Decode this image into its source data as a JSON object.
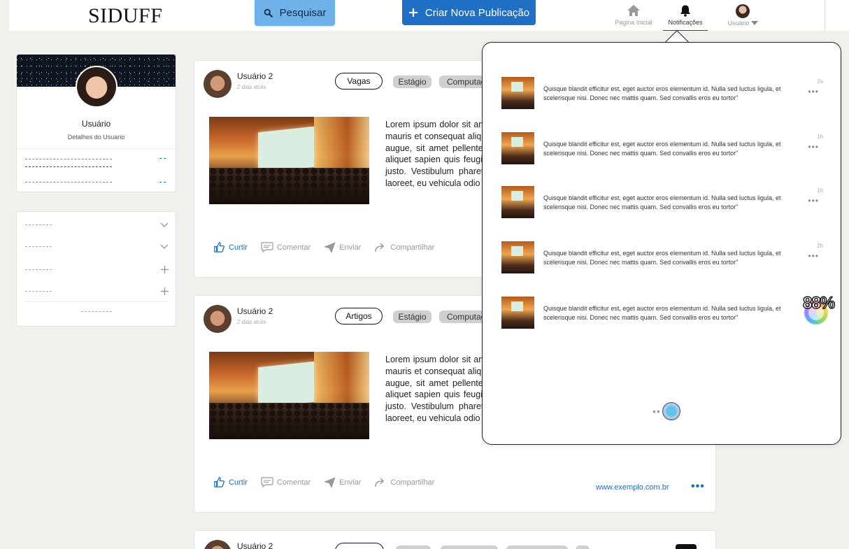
{
  "header": {
    "logo": "SIDUFF",
    "search_label": "Pesquisar",
    "create_label": "Criar Nova Publicação",
    "nav": {
      "home_label": "Pagina Inicial",
      "notifications_label": "Notificações",
      "user_label": "Usuário"
    }
  },
  "profile": {
    "name": "Usuário",
    "details": "Detalhes do Usuario"
  },
  "posts": [
    {
      "user": "Usuário 2",
      "time": "2 dias atrás",
      "category": "Vagas",
      "tags": [
        "Estágio",
        "Computação"
      ],
      "text": "Lorem ipsum dolor sit amet, consectetur adipiscing elit. Nunc malesuada pulvinar, mauris et consequat aliquet. Sed consequat feugiat nisi, vitae aliquam lorem porta augue, sit amet pellentesque nibh blandit eleifend, turpis est tristique orci, eget aliquet sapien quis feugiat. Praesent sit amet dolor, eget pharetra est, vel mattis justo. Vestibulum pharetra consectetur magna, ut ultrices sem libero vitae elit laoreet, eu vehicula odio facilisis.",
      "actions": {
        "like": "Curtir",
        "comment": "Comentar",
        "send": "Enviar",
        "share": "Compartilhar"
      },
      "link": ""
    },
    {
      "user": "Usuário 2",
      "time": "2 dias atrás",
      "category": "Artigos",
      "tags": [
        "Estágio",
        "Computação"
      ],
      "text": "Lorem ipsum dolor sit amet, consectetur adipiscing elit. Nunc malesuada pulvinar, mauris et consequat aliquet. Sed consequat feugiat nisi, vitae aliquam lorem porta augue, sit amet pellentesque nibh blandit eleifend, turpis est tristique orci, eget aliquet sapien quis feugiat. Praesent sit amet dolor, eget pharetra est, vel mattis justo. Vestibulum pharetra consectetur magna, ut ultrices sem libero vitae elit laoreet, eu vehicula odio facilisis.",
      "actions": {
        "like": "Curtir",
        "comment": "Comentar",
        "send": "Enviar",
        "share": "Compartilhar"
      },
      "link": "www.exemplo.com.br"
    },
    {
      "user": "Usuário 2"
    }
  ],
  "notifications": {
    "items": [
      {
        "text": "Quisque blandit efficitur est, eget auctor eros elementum id. Nulla sed luctus ligula, et scelerisque nisi. Donec nec mattis quam. Sed convallis eros eu tortor\"",
        "time": "2s"
      },
      {
        "text": "Quisque blandit efficitur est, eget auctor eros elementum id. Nulla sed luctus ligula, et scelerisque nisi. Donec nec mattis quam. Sed convallis eros eu tortor\"",
        "time": "1h"
      },
      {
        "text": "Quisque blandit efficitur est, eget auctor eros elementum id. Nulla sed luctus ligula, et scelerisque nisi. Donec nec mattis quam. Sed convallis eros eu tortor\"",
        "time": "1h"
      },
      {
        "text": "Quisque blandit efficitur est, eget auctor eros elementum id. Nulla sed luctus ligula, et scelerisque nisi. Donec nec mattis quam. Sed convallis eros eu tortor\"",
        "time": "2h"
      },
      {
        "text": "Quisque blandit efficitur est, eget auctor eros elementum id. Nulla sed luctus ligula, et scelerisque nisi. Donec nec mattis quam. Sed convallis eros eu tortor\"",
        "time": ""
      }
    ],
    "progress_text": "88%"
  },
  "colors": {
    "primary": "#1f6fc4",
    "search_button": "#6fb2ea",
    "tag_bg": "#cfcfcf",
    "page_bg": "#f0f0ed"
  },
  "icons": [
    "search-icon",
    "plus-icon",
    "home-icon",
    "bell-icon",
    "caret-down-icon",
    "chevron-down-icon",
    "thumbs-up-icon",
    "comment-icon",
    "send-icon",
    "share-icon",
    "more-icon"
  ]
}
